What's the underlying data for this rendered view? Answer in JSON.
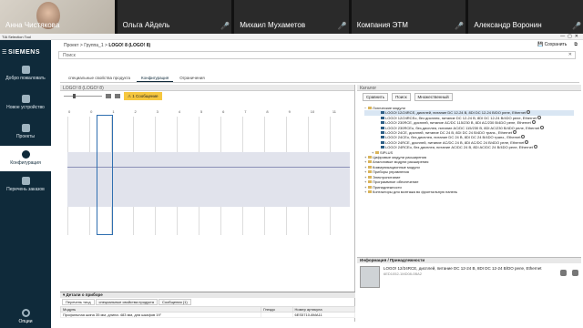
{
  "participants": [
    {
      "name": "Анна Чистякова",
      "camera": true
    },
    {
      "name": "Ольга Айдель",
      "camera": false
    },
    {
      "name": "Михаил Мухаметов",
      "camera": false
    },
    {
      "name": "Компания ЭТМ",
      "camera": false
    },
    {
      "name": "Александр Воронин",
      "camera": false
    }
  ],
  "window": {
    "title": "TIA Selection Tool"
  },
  "sidebar": {
    "brand": "SIEMENS",
    "items": [
      {
        "label": "Добро пожаловать"
      },
      {
        "label": "Новое устройство"
      },
      {
        "label": "Проекты"
      },
      {
        "label": "Конфигурация"
      },
      {
        "label": "Перечень заказов"
      }
    ],
    "options": "Опции"
  },
  "breadcrumb": {
    "p1": "Проект",
    "sep": ">",
    "p2": "Группа_1",
    "p3": "LOGO! 8 (LOGO! 8)"
  },
  "top_buttons": {
    "save": "Сохранить"
  },
  "search": {
    "placeholder": "Поиск"
  },
  "tabs": [
    "специальные свойства продукта",
    "Конфигурация",
    "Ограничения"
  ],
  "left_pane": {
    "title": "LOGO! 8",
    "sub": "(LOGO! 8)",
    "message": "1 Сообщение",
    "slot_numbers": [
      "0",
      "0",
      "1",
      "2",
      "3",
      "4",
      "5",
      "6",
      "7",
      "8",
      "9",
      "10",
      "11"
    ]
  },
  "details": {
    "title": "Детали о приборе",
    "tabs": [
      "Перечень тисд",
      "специальные свойства продукта",
      "Сообщения (1)"
    ],
    "columns": [
      "Модуль",
      "Гнездо",
      "Номер артикула"
    ],
    "rows": [
      [
        "Профильная шина 35 мм, длина: 483 мм, для шкафов 19\"",
        "",
        "6ES5710-8MA11"
      ]
    ]
  },
  "catalog": {
    "title": "Каталог",
    "buttons": [
      "Сравнить",
      "Поиск",
      "Множественный"
    ],
    "tree": [
      {
        "level": 1,
        "text": "Логические модули",
        "open": true
      },
      {
        "level": 3,
        "text": "LOGO! 12/24RCE, дисплей, питание DC 12-24 В, 8DI DC 12-24 В/DO реле, Ethernet",
        "selected": true
      },
      {
        "level": 3,
        "text": "LOGO! 12/24RCEo, без дисплея, питание DC 12-24 В, 8DI DC 12-24 В/4DO реле, Ethernet"
      },
      {
        "level": 3,
        "text": "LOGO! 230RCE, дисплей, питание AC/DC 115/230 В, 8DI AC/230 В/4DO реле, Ethernet"
      },
      {
        "level": 3,
        "text": "LOGO! 230RCEo, без дисплея, питание AC/DC 115/230 В, 8DI AC/230 В/4DO реле, Ethernet"
      },
      {
        "level": 3,
        "text": "LOGO! 24CE, дисплей, питание DC 24 В, 8DI DC 24 В/4DO транз., Ethernet"
      },
      {
        "level": 3,
        "text": "LOGO! 24CEo, без дисплея, питание DC 24 В, 8DI DC 24 В/4DO транз., Ethernet"
      },
      {
        "level": 3,
        "text": "LOGO! 24RCE, дисплей, питание AC/DC 24 В, 8DI AC/DC 24 В/4DO реле, Ethernet"
      },
      {
        "level": 3,
        "text": "LOGO! 24RCEo, без дисплея, питание AC/DC 24 В, 8DI AC/DC 24 В/4DO реле, Ethernet"
      },
      {
        "level": 2,
        "text": "SIPLUS",
        "open": false
      },
      {
        "level": 1,
        "text": "Цифровые модули расширения"
      },
      {
        "level": 1,
        "text": "Аналоговые модули расширения"
      },
      {
        "level": 1,
        "text": "Коммуникационные модули"
      },
      {
        "level": 1,
        "text": "Приборы управления"
      },
      {
        "level": 1,
        "text": "Электропитание"
      },
      {
        "level": 1,
        "text": "Программное обеспечение"
      },
      {
        "level": 1,
        "text": "Принадлежности"
      },
      {
        "level": 1,
        "text": "Контакторы для монтажа во фронтальную панель"
      }
    ]
  },
  "info": {
    "title": "Информация / Принадлежности",
    "product": "LOGO! 12/24RCE, дисплей, питание DC 12-24 В, 8DI DC 12-24 В/DO реле, Ethernet",
    "article": "6ED1052-1MD08-0BA2"
  }
}
